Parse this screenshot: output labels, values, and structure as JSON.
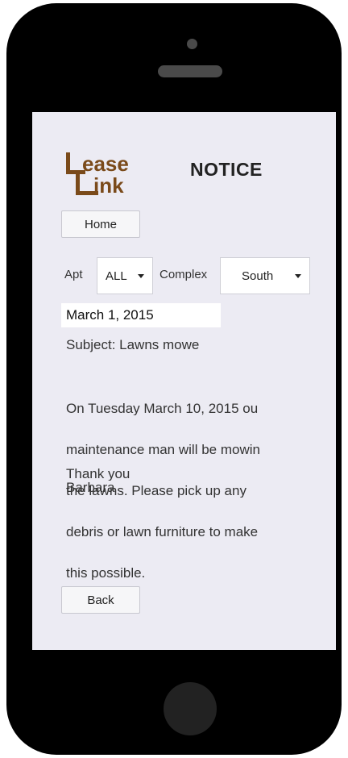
{
  "logo": {
    "line1": "ease",
    "line2": "ink"
  },
  "header": {
    "title": "NOTICE"
  },
  "nav": {
    "home_label": "Home",
    "back_label": "Back"
  },
  "filters": {
    "apt_label": "Apt",
    "apt_value": "ALL",
    "complex_label": "Complex",
    "complex_value": "South"
  },
  "notice": {
    "date": "March 1, 2015",
    "subject": "Subject: Lawns mowe",
    "body_lines": [
      "On Tuesday March 10, 2015 ou",
      "maintenance man will be mowin",
      "the lawns.  Please pick up any",
      "debris or lawn furniture to make",
      "this possible."
    ],
    "signoff_lines": [
      "Thank you",
      "Barbara"
    ]
  },
  "colors": {
    "logo_brown": "#7a4a1a",
    "screen_bg": "#ecebf3"
  }
}
